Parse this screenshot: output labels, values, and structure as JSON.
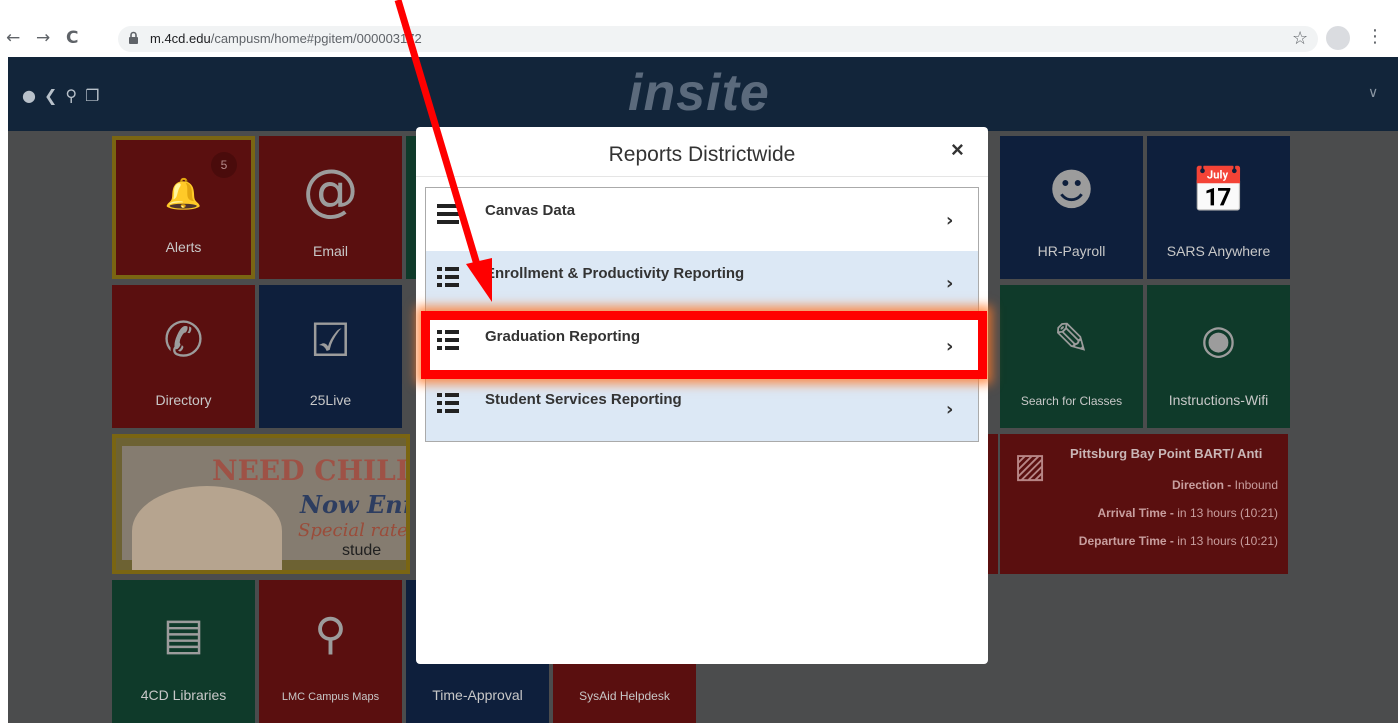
{
  "browser": {
    "url_host": "m.4cd.edu",
    "url_path": "/campusm/home#pgitem/",
    "url_tail": "000003172",
    "back": "←",
    "forward": "→",
    "reload": "C",
    "star": "☆",
    "menu": "⋮"
  },
  "topbar": {
    "brand": "insite",
    "icons": [
      "chat-icon",
      "share-icon",
      "search-icon",
      "copy-icon"
    ]
  },
  "tiles": {
    "alerts": {
      "label": "Alerts",
      "badge": "5"
    },
    "email": {
      "label": "Email"
    },
    "hr_payroll": {
      "label": "HR-Payroll"
    },
    "sars": {
      "label": "SARS Anywhere"
    },
    "directory": {
      "label": "Directory"
    },
    "live25": {
      "label": "25Live"
    },
    "search_classes": {
      "label": "Search for Classes"
    },
    "wifi": {
      "label": "Instructions-Wifi"
    },
    "libraries": {
      "label": "4CD Libraries"
    },
    "maps": {
      "label": "LMC Campus Maps"
    },
    "time_approval": {
      "label": "Time-Approval"
    },
    "sysaid": {
      "label": "SysAid Helpdesk"
    }
  },
  "promo": {
    "line1": "NEED CHILD C",
    "line2": "Now Enr",
    "line3": "Special rate",
    "line4": "stude"
  },
  "bart": {
    "title": "Pittsburg Bay Point BART/ Anti",
    "direction_label": "Direction - ",
    "direction_value": "Inbound",
    "arrival_label": "Arrival Time - ",
    "arrival_value": "in 13 hours (10:21)",
    "departure_label": "Departure Time - ",
    "departure_value": "in 13 hours (10:21)"
  },
  "modal": {
    "title": "Reports Districtwide",
    "close": "×",
    "items": [
      {
        "label": "Canvas Data"
      },
      {
        "label": "Enrollment & Productivity Reporting"
      },
      {
        "label": "Graduation Reporting"
      },
      {
        "label": "Student Services Reporting"
      }
    ]
  },
  "colors": {
    "row_alt": "#dce8f5",
    "highlight": "#ff0000",
    "topbar": "#12253a"
  }
}
